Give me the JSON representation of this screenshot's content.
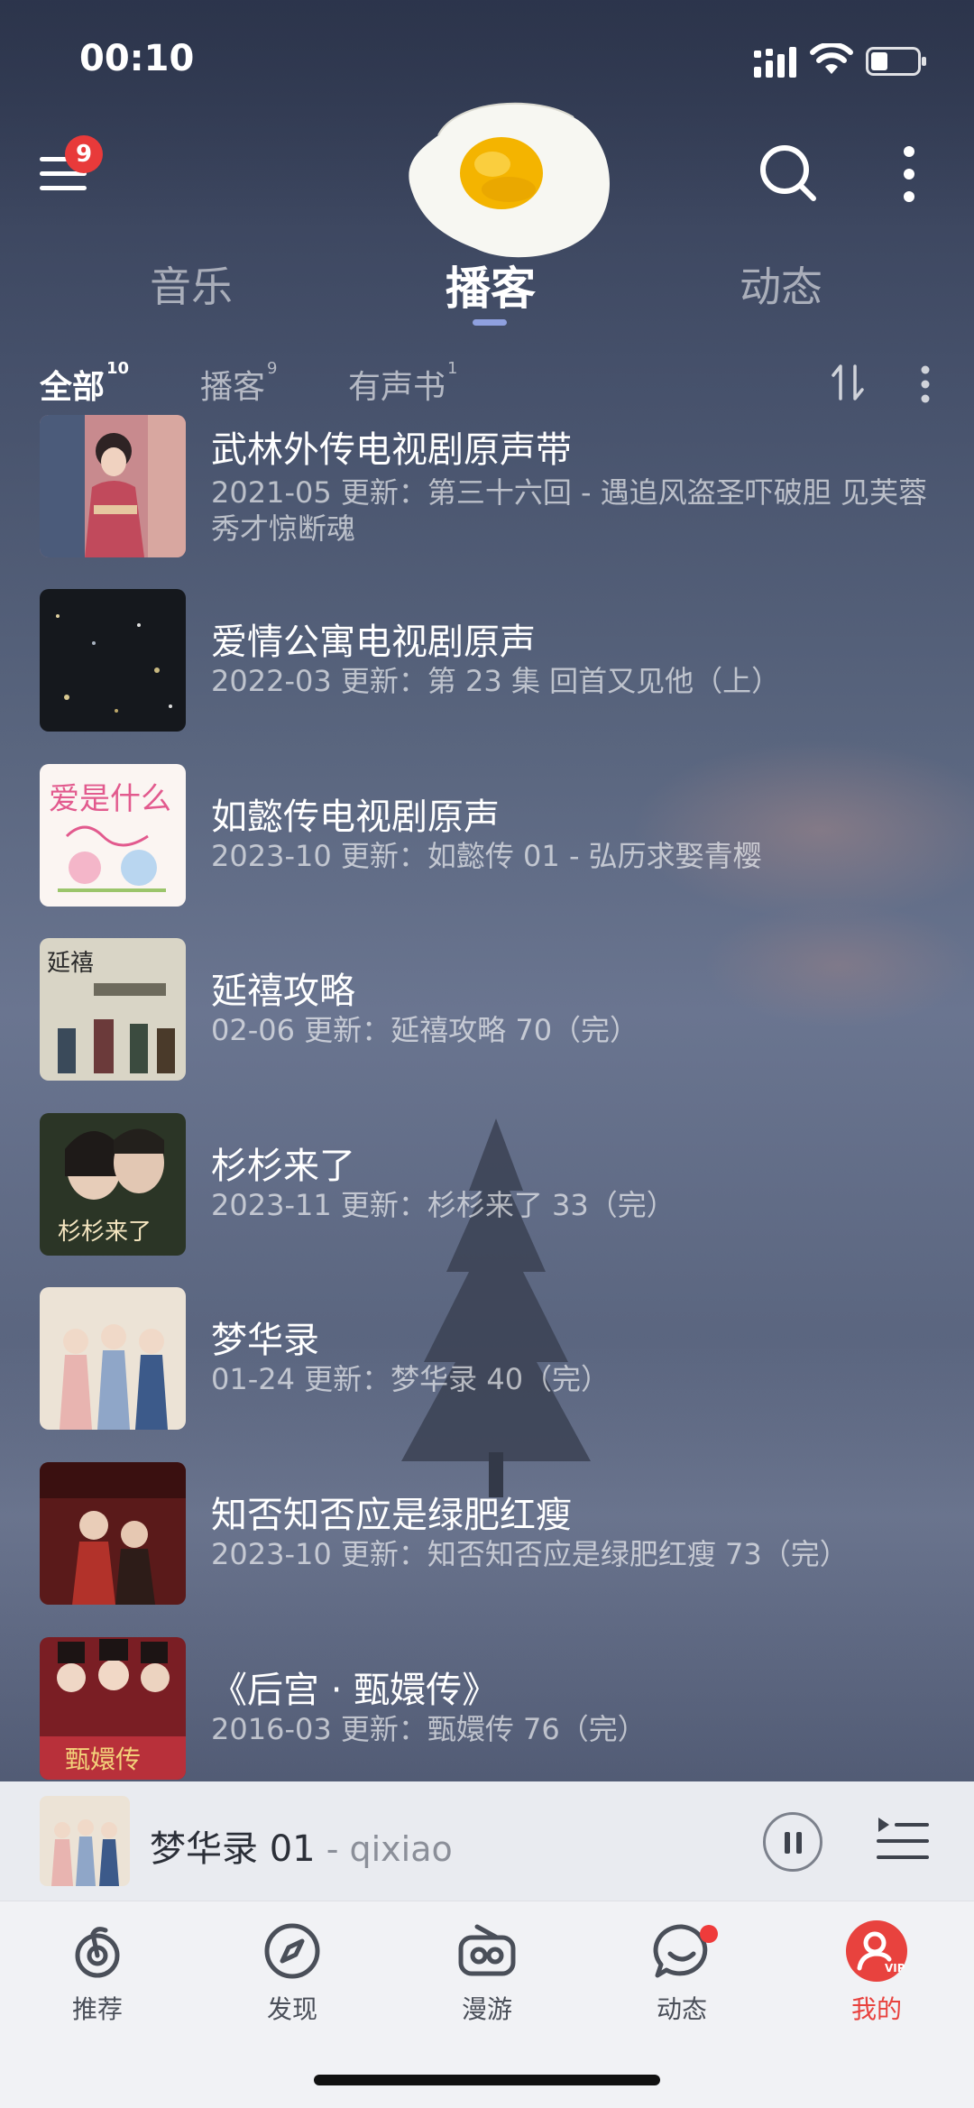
{
  "status_bar": {
    "time": "00:10"
  },
  "header": {
    "menu_badge": "9"
  },
  "main_tabs": [
    {
      "label": "音乐",
      "active": false
    },
    {
      "label": "播客",
      "active": true
    },
    {
      "label": "动态",
      "active": false
    }
  ],
  "sub_tabs": [
    {
      "label": "全部",
      "count": "10",
      "active": true
    },
    {
      "label": "播客",
      "count": "9",
      "active": false
    },
    {
      "label": "有声书",
      "count": "1",
      "active": false
    }
  ],
  "items": [
    {
      "title": "武林外传电视剧原声带",
      "subtitle": "2021-05 更新：第三十六回 - 遇追风盗圣吓破胆 见芙蓉秀才惊断魂",
      "cover": "wulin-cover"
    },
    {
      "title": "爱情公寓电视剧原声",
      "subtitle": "2022-03 更新：第 23 集 回首又见他（上）",
      "cover": "aiqing-cover"
    },
    {
      "title": "如懿传电视剧原声",
      "subtitle": "2023-10 更新：如懿传 01 - 弘历求娶青樱",
      "cover": "ruyi-cover"
    },
    {
      "title": "延禧攻略",
      "subtitle": "02-06 更新：延禧攻略 70（完）",
      "cover": "yanxi-cover"
    },
    {
      "title": "杉杉来了",
      "subtitle": "2023-11 更新：杉杉来了 33（完）",
      "cover": "shanshan-cover"
    },
    {
      "title": "梦华录",
      "subtitle": "01-24 更新：梦华录 40（完）",
      "cover": "menghua-cover"
    },
    {
      "title": "知否知否应是绿肥红瘦",
      "subtitle": "2023-10 更新：知否知否应是绿肥红瘦 73（完）",
      "cover": "zhifou-cover"
    },
    {
      "title": "《后宫 · 甄嬛传》",
      "subtitle": "2016-03 更新：甄嬛传 76（完）",
      "cover": "zhenhuan-cover"
    }
  ],
  "player": {
    "title": "梦华录 01",
    "artist": " - qixiao",
    "state": "playing"
  },
  "bottom_nav": [
    {
      "label": "推荐",
      "icon": "recommend-icon",
      "active": false
    },
    {
      "label": "发现",
      "icon": "compass-icon",
      "active": false
    },
    {
      "label": "漫游",
      "icon": "radio-icon",
      "active": false
    },
    {
      "label": "动态",
      "icon": "chat-icon",
      "active": false
    },
    {
      "label": "我的",
      "icon": "profile-vip-icon",
      "active": true
    }
  ],
  "colors": {
    "accent": "#e8423e",
    "tab_indicator": "#8fa1e0",
    "badge": "#e83a3a"
  }
}
